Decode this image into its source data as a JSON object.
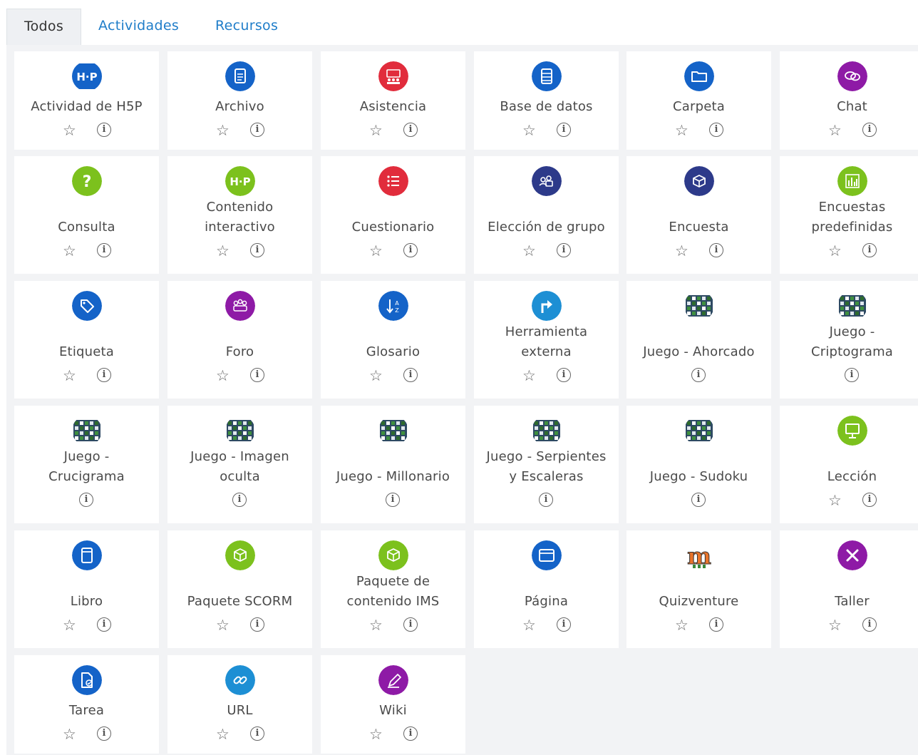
{
  "tabs": [
    {
      "label": "Todos",
      "active": true
    },
    {
      "label": "Actividades",
      "active": false
    },
    {
      "label": "Recursos",
      "active": false
    }
  ],
  "colors": {
    "blue": "#1463c8",
    "red": "#e12c3c",
    "purple": "#8e1aa6",
    "green": "#7cc11d",
    "navy": "#2d3a8a",
    "teal": "#1d8fd4",
    "link": "#1f7dc9"
  },
  "items": [
    {
      "name": "Actividad de H5P",
      "lines": [
        "Actividad de H5P"
      ],
      "icon": "h5p-icon",
      "color": "#1463c8",
      "star": true
    },
    {
      "name": "Archivo",
      "lines": [
        "Archivo"
      ],
      "icon": "file-icon",
      "color": "#1463c8",
      "star": true
    },
    {
      "name": "Asistencia",
      "lines": [
        "Asistencia"
      ],
      "icon": "attendance-icon",
      "color": "#e12c3c",
      "star": true
    },
    {
      "name": "Base de datos",
      "lines": [
        "Base de datos"
      ],
      "icon": "database-icon",
      "color": "#1463c8",
      "star": true
    },
    {
      "name": "Carpeta",
      "lines": [
        "Carpeta"
      ],
      "icon": "folder-icon",
      "color": "#1463c8",
      "star": true
    },
    {
      "name": "Chat",
      "lines": [
        "Chat"
      ],
      "icon": "chat-icon",
      "color": "#8e1aa6",
      "star": true
    },
    {
      "name": "Consulta",
      "lines": [
        "Consulta"
      ],
      "icon": "question-icon",
      "color": "#7cc11d",
      "star": true
    },
    {
      "name": "Contenido interactivo",
      "lines": [
        "Contenido",
        "interactivo"
      ],
      "icon": "h5p-icon",
      "color": "#7cc11d",
      "star": true
    },
    {
      "name": "Cuestionario",
      "lines": [
        "Cuestionario"
      ],
      "icon": "list-icon",
      "color": "#e12c3c",
      "star": true
    },
    {
      "name": "Elección de grupo",
      "lines": [
        "Elección de grupo"
      ],
      "icon": "group-icon",
      "color": "#2d3a8a",
      "star": true
    },
    {
      "name": "Encuesta",
      "lines": [
        "Encuesta"
      ],
      "icon": "survey-icon",
      "color": "#2d3a8a",
      "star": true
    },
    {
      "name": "Encuestas predefinidas",
      "lines": [
        "Encuestas",
        "predefinidas"
      ],
      "icon": "bar-chart-icon",
      "color": "#7cc11d",
      "star": true
    },
    {
      "name": "Etiqueta",
      "lines": [
        "Etiqueta"
      ],
      "icon": "tag-icon",
      "color": "#1463c8",
      "star": true
    },
    {
      "name": "Foro",
      "lines": [
        "Foro"
      ],
      "icon": "forum-icon",
      "color": "#8e1aa6",
      "star": true
    },
    {
      "name": "Glosario",
      "lines": [
        "Glosario"
      ],
      "icon": "sort-icon",
      "color": "#1463c8",
      "star": true
    },
    {
      "name": "Herramienta externa",
      "lines": [
        "Herramienta",
        "externa"
      ],
      "icon": "external-tool-icon",
      "color": "#1d8fd4",
      "star": true
    },
    {
      "name": "Juego - Ahorcado",
      "lines": [
        "Juego - Ahorcado"
      ],
      "icon": "game-board-icon",
      "color": "#ffffff",
      "star": false
    },
    {
      "name": "Juego - Criptograma",
      "lines": [
        "Juego -",
        "Criptograma"
      ],
      "icon": "game-board-icon",
      "color": "#ffffff",
      "star": false
    },
    {
      "name": "Juego - Crucigrama",
      "lines": [
        "Juego -",
        "Crucigrama"
      ],
      "icon": "game-board-icon",
      "color": "#ffffff",
      "star": false
    },
    {
      "name": "Juego - Imagen oculta",
      "lines": [
        "Juego - Imagen",
        "oculta"
      ],
      "icon": "game-board-icon",
      "color": "#ffffff",
      "star": false
    },
    {
      "name": "Juego - Millonario",
      "lines": [
        "Juego - Millonario"
      ],
      "icon": "game-board-icon",
      "color": "#ffffff",
      "star": false
    },
    {
      "name": "Juego - Serpientes y Escaleras",
      "lines": [
        "Juego - Serpientes",
        "y Escaleras"
      ],
      "icon": "game-board-icon",
      "color": "#ffffff",
      "star": false
    },
    {
      "name": "Juego - Sudoku",
      "lines": [
        "Juego - Sudoku"
      ],
      "icon": "game-board-icon",
      "color": "#ffffff",
      "star": false
    },
    {
      "name": "Lección",
      "lines": [
        "Lección"
      ],
      "icon": "presentation-icon",
      "color": "#7cc11d",
      "star": true
    },
    {
      "name": "Libro",
      "lines": [
        "Libro"
      ],
      "icon": "book-icon",
      "color": "#1463c8",
      "star": true
    },
    {
      "name": "Paquete SCORM",
      "lines": [
        "Paquete SCORM"
      ],
      "icon": "package-icon",
      "color": "#7cc11d",
      "star": true
    },
    {
      "name": "Paquete de contenido IMS",
      "lines": [
        "Paquete de",
        "contenido IMS"
      ],
      "icon": "package-icon",
      "color": "#7cc11d",
      "star": true
    },
    {
      "name": "Página",
      "lines": [
        "Página"
      ],
      "icon": "page-icon",
      "color": "#1463c8",
      "star": true
    },
    {
      "name": "Quizventure",
      "lines": [
        "Quizventure"
      ],
      "icon": "quizventure-icon",
      "color": "#ffffff",
      "star": true
    },
    {
      "name": "Taller",
      "lines": [
        "Taller"
      ],
      "icon": "tools-icon",
      "color": "#8e1aa6",
      "star": true
    },
    {
      "name": "Tarea",
      "lines": [
        "Tarea"
      ],
      "icon": "assignment-icon",
      "color": "#1463c8",
      "star": true
    },
    {
      "name": "URL",
      "lines": [
        "URL"
      ],
      "icon": "link-icon",
      "color": "#1d8fd4",
      "star": true
    },
    {
      "name": "Wiki",
      "lines": [
        "Wiki"
      ],
      "icon": "wiki-icon",
      "color": "#8e1aa6",
      "star": true
    }
  ],
  "star_glyph": "☆",
  "info_glyph": "i"
}
